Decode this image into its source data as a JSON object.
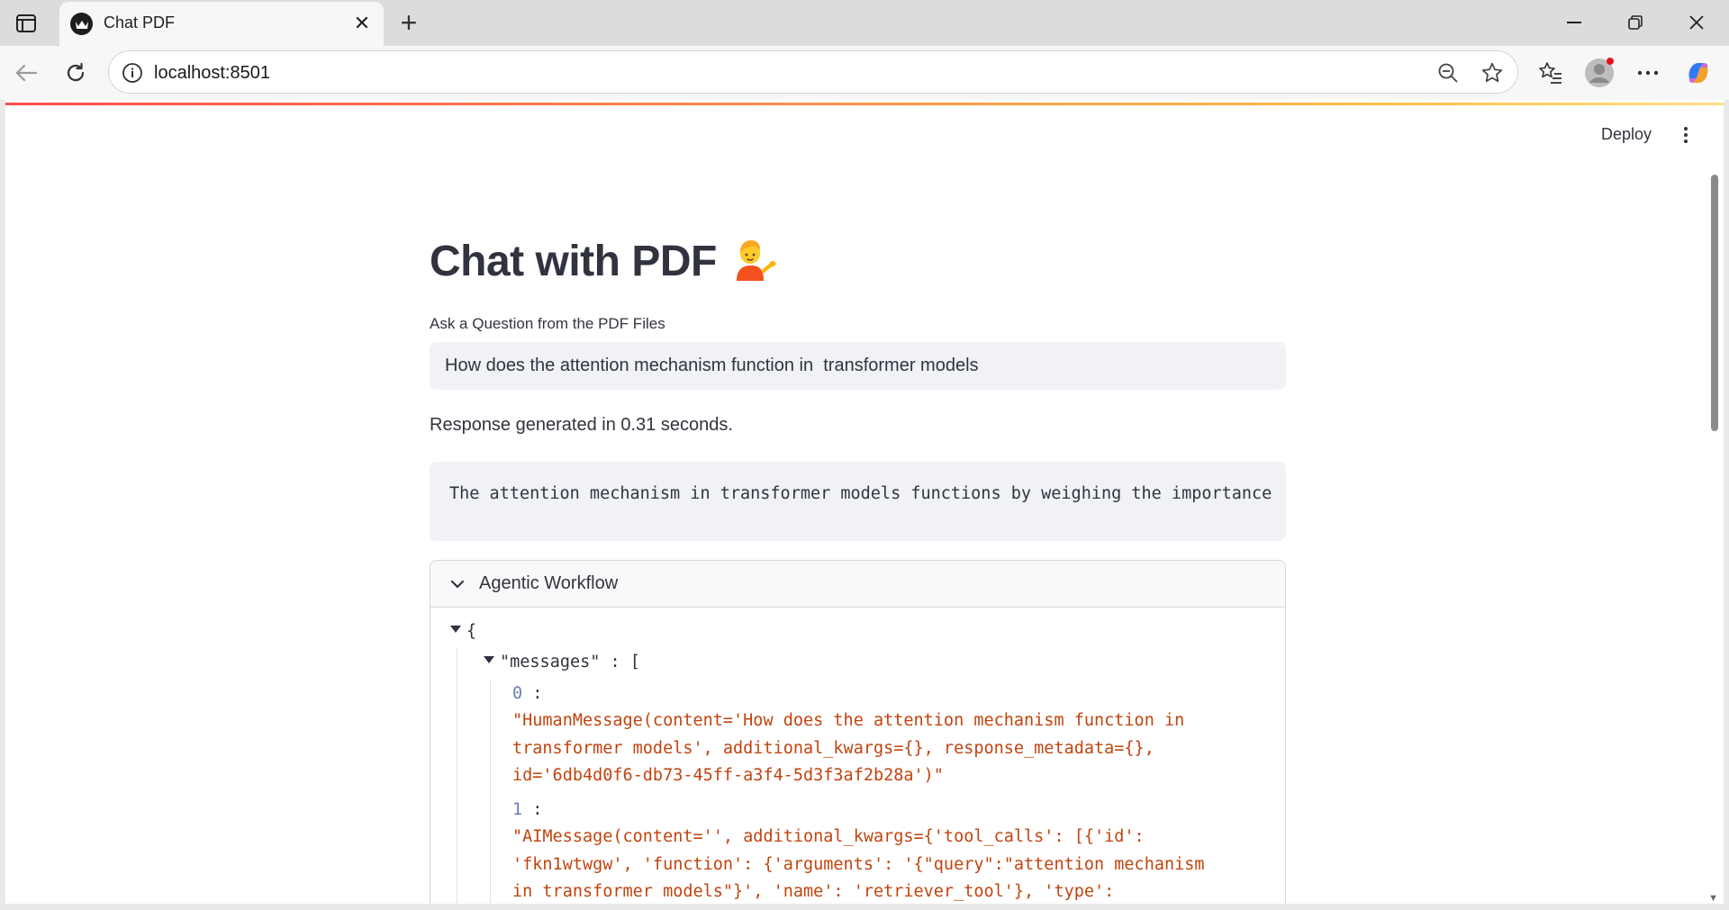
{
  "browser": {
    "tab_title": "Chat PDF",
    "url": "localhost:8501",
    "new_tab_symbol": "+",
    "close_tab_symbol": "✕"
  },
  "app": {
    "deploy_label": "Deploy",
    "title": "Chat with PDF",
    "input_label": "Ask a Question from the PDF Files",
    "question_value": "How does the attention mechanism function in  transformer models",
    "timing_text": "Response generated in 0.31 seconds.",
    "answer_code": "The attention mechanism in transformer models functions by weighing the importance",
    "expander_title": "Agentic Workflow",
    "json_view": {
      "open_brace": "{",
      "messages_key": "\"messages\"",
      "colon_bracket": " : [",
      "items": [
        {
          "index": "0",
          "colon": " :",
          "lines": [
            "\"HumanMessage(content='How does the attention mechanism function in",
            "transformer models', additional_kwargs={}, response_metadata={},",
            "id='6db4d0f6-db73-45ff-a3f4-5d3f3af2b28a')\""
          ]
        },
        {
          "index": "1",
          "colon": " :",
          "lines": [
            "\"AIMessage(content='', additional_kwargs={'tool_calls': [{'id':",
            "'fkn1wtwgw', 'function': {'arguments': '{\"query\":\"attention mechanism",
            "in transformer models\"}', 'name': 'retriever_tool'}, 'type':"
          ]
        }
      ]
    }
  },
  "colors": {
    "accent_gradient_start": "#ff4b4b",
    "accent_gradient_end": "#ffbd45",
    "json_string": "#c1440e",
    "json_index": "#6b7fb5"
  }
}
